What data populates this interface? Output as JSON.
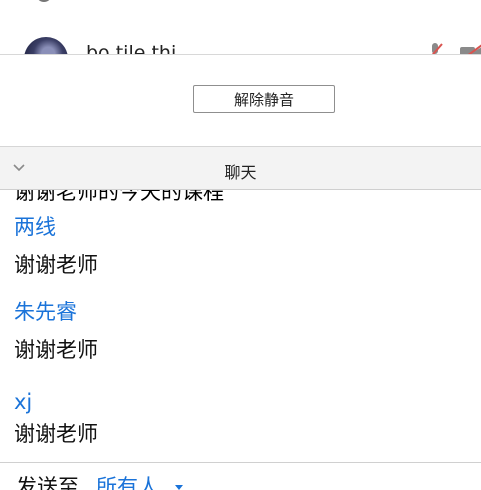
{
  "participants": {
    "partial_name": "bo tile thi...",
    "unmute_all_label": "解除静音"
  },
  "chat": {
    "title": "聊天",
    "partial_message": "谢谢老师的今天的课程",
    "messages": [
      {
        "sender": "两线",
        "text": "谢谢老师"
      },
      {
        "sender": "朱先睿",
        "text": "谢谢老师"
      },
      {
        "sender": "xj",
        "text": "谢谢老师"
      }
    ],
    "send_to_label": "发送至",
    "recipient": "所有人"
  },
  "colors": {
    "link_blue": "#1a73d9",
    "header_bg": "#f3f3f3"
  }
}
